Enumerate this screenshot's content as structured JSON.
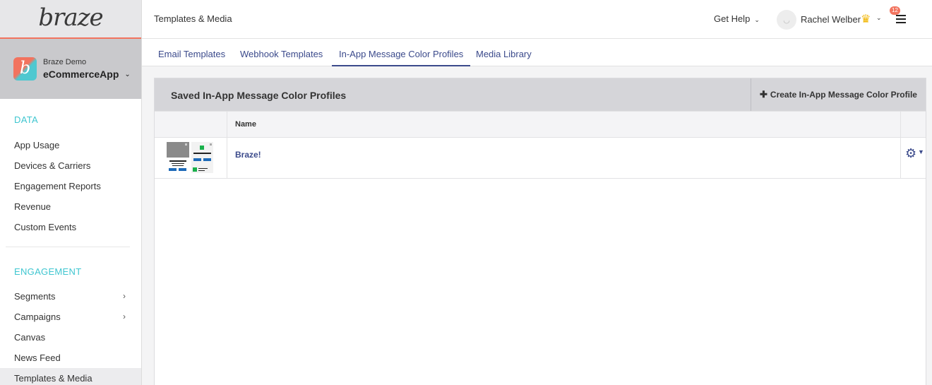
{
  "logo": {
    "text": "braze"
  },
  "app": {
    "company": "Braze Demo",
    "name": "eCommerceApp",
    "icon_letter": "b"
  },
  "sidebar": {
    "sections": [
      {
        "title": "DATA",
        "items": [
          {
            "label": "App Usage"
          },
          {
            "label": "Devices & Carriers"
          },
          {
            "label": "Engagement Reports"
          },
          {
            "label": "Revenue"
          },
          {
            "label": "Custom Events"
          }
        ]
      },
      {
        "title": "ENGAGEMENT",
        "items": [
          {
            "label": "Segments",
            "has_arrow": true
          },
          {
            "label": "Campaigns",
            "has_arrow": true
          },
          {
            "label": "Canvas"
          },
          {
            "label": "News Feed"
          },
          {
            "label": "Templates & Media",
            "active": true
          }
        ]
      }
    ]
  },
  "topbar": {
    "title": "Templates & Media",
    "help": "Get Help",
    "user": "Rachel Welber",
    "notifications": "12"
  },
  "tabs": [
    {
      "label": "Email Templates"
    },
    {
      "label": "Webhook Templates"
    },
    {
      "label": "In-App Message Color Profiles",
      "active": true
    },
    {
      "label": "Media Library"
    }
  ],
  "panel": {
    "title": "Saved In-App Message Color Profiles",
    "create_label": "Create In-App Message Color Profile",
    "columns": {
      "name": "Name"
    },
    "rows": [
      {
        "name": "Braze!"
      }
    ]
  },
  "colors": {
    "accent": "#3b4a8b",
    "teal": "#3fc6d0",
    "coral": "#f2735e",
    "sidebar_header": "#c9c9cc"
  }
}
